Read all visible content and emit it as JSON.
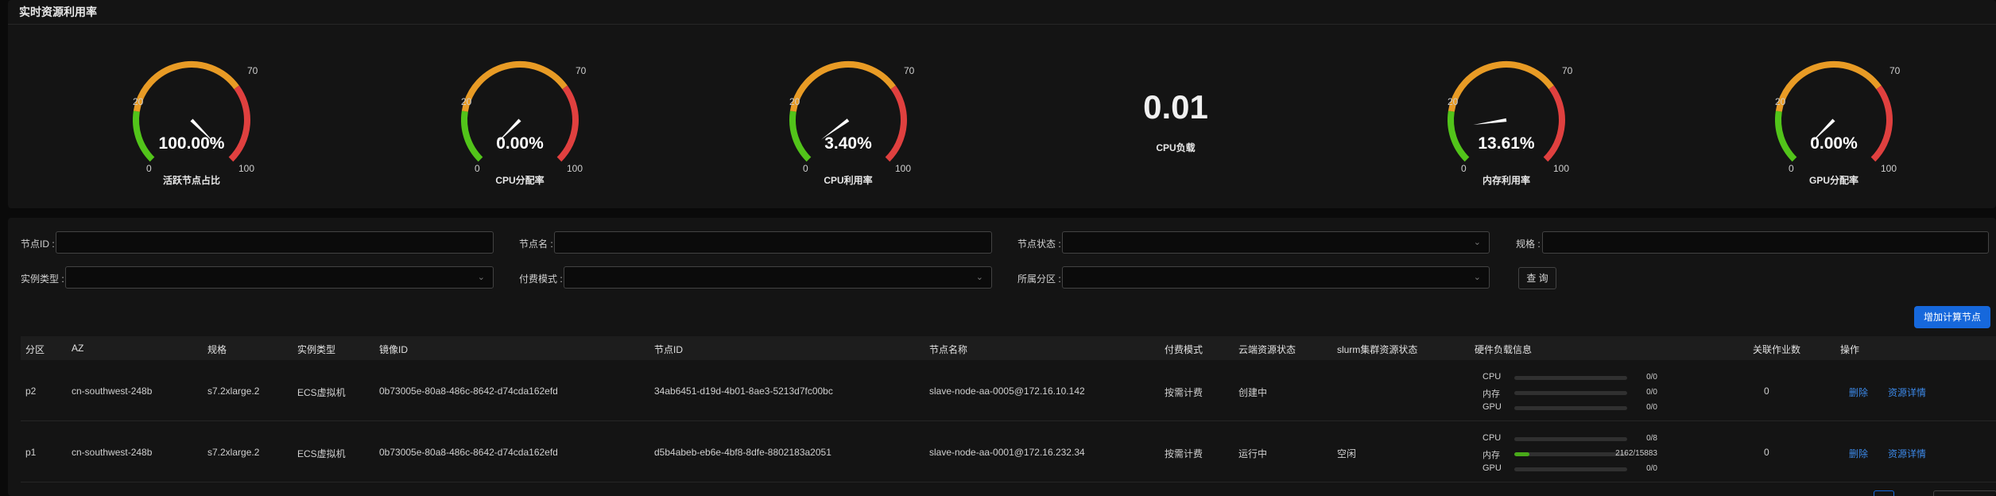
{
  "top": {
    "title": "实时资源利用率",
    "tick_labels": [
      "0",
      "20",
      "70",
      "100"
    ],
    "colors": {
      "green": "#52c41a",
      "orange": "#e89b25",
      "red": "#e0403f"
    },
    "gauges": [
      {
        "value": "100.00%",
        "label": "活跃节点占比",
        "percent": 100
      },
      {
        "value": "0.00%",
        "label": "CPU分配率",
        "percent": 0
      },
      {
        "value": "3.40%",
        "label": "CPU利用率",
        "percent": 3.4
      },
      {
        "value": "13.61%",
        "label": "内存利用率",
        "percent": 13.61
      },
      {
        "value": "0.00%",
        "label": "GPU分配率",
        "percent": 0
      }
    ],
    "cpu_load": {
      "value": "0.01",
      "label": "CPU负载"
    }
  },
  "filters": {
    "node_id": "节点ID :",
    "node_name": "节点名 :",
    "node_status": "节点状态 :",
    "spec": "规格 :",
    "instance_type": "实例类型 :",
    "billing_mode": "付费模式 :",
    "partition": "所属分区 :",
    "query_button": "查 询",
    "add_button": "增加计算节点"
  },
  "table": {
    "columns": [
      "分区",
      "AZ",
      "规格",
      "实例类型",
      "镜像ID",
      "节点ID",
      "节点名称",
      "付费模式",
      "云端资源状态",
      "slurm集群资源状态",
      "硬件负载信息",
      "关联作业数",
      "操作"
    ],
    "rows": [
      {
        "partition": "p2",
        "az": "cn-southwest-248b",
        "spec": "s7.2xlarge.2",
        "instance_type": "ECS虚拟机",
        "image_id": "0b73005e-80a8-486c-8642-d74cda162efd",
        "node_id": "34ab6451-d19d-4b01-8ae3-5213d7fc00bc",
        "node_name": "slave-node-aa-0005@172.16.10.142",
        "billing": "按需计费",
        "cloud_status": "创建中",
        "slurm_status": "",
        "hw": [
          {
            "name": "CPU",
            "text": "0/0",
            "fraction": 0
          },
          {
            "name": "内存",
            "text": "0/0",
            "fraction": 0
          },
          {
            "name": "GPU",
            "text": "0/0",
            "fraction": 0
          }
        ],
        "jobs": "0",
        "delete": "删除",
        "detail": "资源详情"
      },
      {
        "partition": "p1",
        "az": "cn-southwest-248b",
        "spec": "s7.2xlarge.2",
        "instance_type": "ECS虚拟机",
        "image_id": "0b73005e-80a8-486c-8642-d74cda162efd",
        "node_id": "d5b4abeb-eb6e-4bf8-8dfe-8802183a2051",
        "node_name": "slave-node-aa-0001@172.16.232.34",
        "billing": "按需计费",
        "cloud_status": "运行中",
        "slurm_status": "空闲",
        "hw": [
          {
            "name": "CPU",
            "text": "0/8",
            "fraction": 0
          },
          {
            "name": "内存",
            "text": "2162/15883",
            "fraction": 0.136
          },
          {
            "name": "GPU",
            "text": "0/0",
            "fraction": 0
          }
        ],
        "jobs": "0",
        "delete": "删除",
        "detail": "资源详情"
      }
    ]
  }
}
